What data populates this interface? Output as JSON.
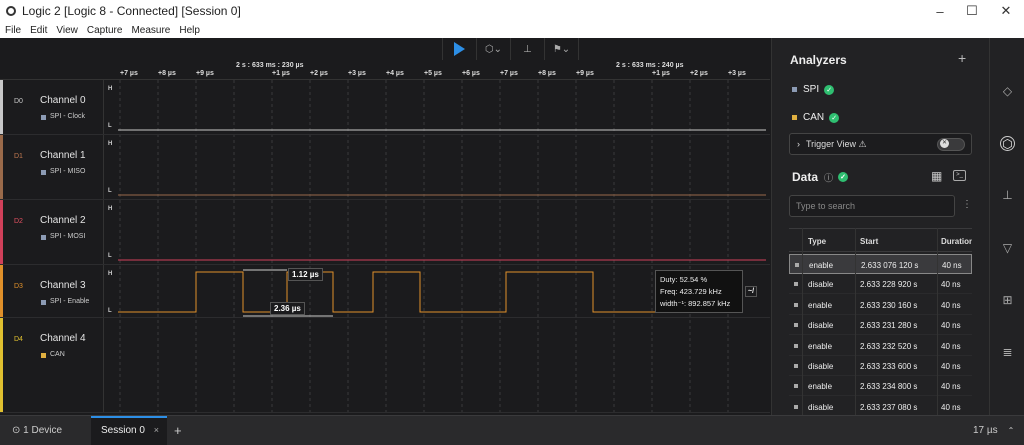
{
  "window": {
    "title": "Logic 2 [Logic 8 - Connected] [Session 0]",
    "minimize": "–",
    "maximize": "☐",
    "close": "✕"
  },
  "menu": [
    "File",
    "Edit",
    "View",
    "Capture",
    "Measure",
    "Help"
  ],
  "timeline": {
    "stamp_left": "2 s : 633 ms : 230 µs",
    "stamp_right": "2 s : 633 ms : 240 µs",
    "ticks": [
      "+7 µs",
      "+8 µs",
      "+9 µs",
      "+1 µs",
      "+2 µs",
      "+3 µs",
      "+4 µs",
      "+5 µs",
      "+6 µs",
      "+7 µs",
      "+8 µs",
      "+9 µs",
      "+1 µs",
      "+2 µs",
      "+3 µs"
    ]
  },
  "channels": [
    {
      "id": "D0",
      "name": "Channel 0",
      "analyzer": "SPI - Clock",
      "color": "#c8c8c8",
      "id_color": "#c8c8c8",
      "high": "H",
      "low": "L",
      "dot": "#8c9bb4"
    },
    {
      "id": "D1",
      "name": "Channel 1",
      "analyzer": "SPI - MISO",
      "color": "#9a6a4a",
      "id_color": "#c07850",
      "high": "H",
      "low": "L",
      "dot": "#8c9bb4"
    },
    {
      "id": "D2",
      "name": "Channel 2",
      "analyzer": "SPI - MOSI",
      "color": "#d0405a",
      "id_color": "#e05060",
      "high": "H",
      "low": "L",
      "dot": "#8c9bb4"
    },
    {
      "id": "D3",
      "name": "Channel 3",
      "analyzer": "SPI - Enable",
      "color": "#e0902a",
      "id_color": "#e0902a",
      "high": "H",
      "low": "L",
      "dot": "#8c9bb4"
    },
    {
      "id": "D4",
      "name": "Channel 4",
      "analyzer": "CAN",
      "color": "#e0c030",
      "id_color": "#e0c030",
      "high": "",
      "low": "",
      "dot": "#e0b040"
    }
  ],
  "measurements": {
    "pulse_width": "1.12 µs",
    "period": "2.36 µs"
  },
  "tooltip": {
    "duty": "Duty: 52.54 %",
    "freq": "Freq: 423.729 kHz",
    "width": "width⁻¹: 892.857 kHz"
  },
  "panel": {
    "analyzers_title": "Analyzers",
    "add": "+",
    "analyzers": [
      {
        "name": "SPI",
        "color": "#8c9bb4"
      },
      {
        "name": "CAN",
        "color": "#e0b040"
      }
    ],
    "trigger_label": "Trigger View ⚠",
    "data_title": "Data",
    "search_placeholder": "Type to search",
    "columns": [
      "Type",
      "Start",
      "Duration"
    ],
    "rows": [
      {
        "type": "enable",
        "start": "2.633 076 120 s",
        "duration": "40 ns"
      },
      {
        "type": "disable",
        "start": "2.633 228 920 s",
        "duration": "40 ns"
      },
      {
        "type": "enable",
        "start": "2.633 230 160 s",
        "duration": "40 ns"
      },
      {
        "type": "disable",
        "start": "2.633 231 280 s",
        "duration": "40 ns"
      },
      {
        "type": "enable",
        "start": "2.633 232 520 s",
        "duration": "40 ns"
      },
      {
        "type": "disable",
        "start": "2.633 233 600 s",
        "duration": "40 ns"
      },
      {
        "type": "enable",
        "start": "2.633 234 800 s",
        "duration": "40 ns"
      },
      {
        "type": "disable",
        "start": "2.633 237 080 s",
        "duration": "40 ns"
      }
    ]
  },
  "status": {
    "device": "1 Device",
    "session_tab": "Session 0",
    "session_close": "×",
    "add_tab": "+",
    "zoom": "17 µs"
  },
  "colors": {
    "accent": "#2d8fe6",
    "ok": "#2fbf71"
  }
}
